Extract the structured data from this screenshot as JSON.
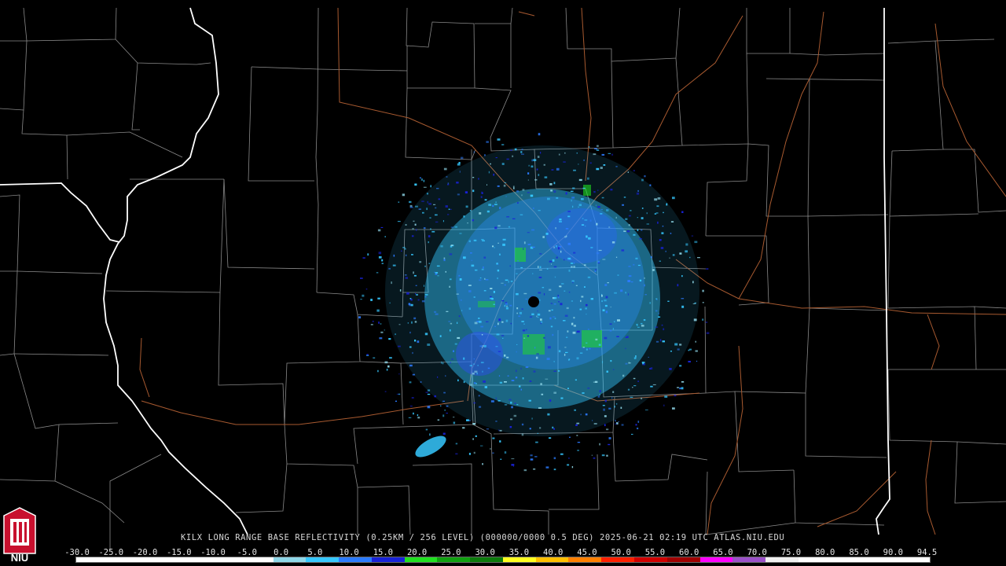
{
  "caption": "KILX LONG RANGE BASE REFLECTIVITY (0.25KM / 256 LEVEL) (000000/0000 0.5 DEG) 2025-06-21 02:19 UTC  ATLAS.NIU.EDU",
  "logo": {
    "text": "NIU"
  },
  "radar_site": {
    "id": "KILX"
  },
  "scale": {
    "labels": [
      "-30.0",
      "-25.0",
      "-20.0",
      "-15.0",
      "-10.0",
      "-5.0",
      "0.0",
      "5.0",
      "10.0",
      "15.0",
      "20.0",
      "25.0",
      "30.0",
      "35.0",
      "40.0",
      "45.0",
      "50.0",
      "55.0",
      "60.0",
      "65.0",
      "70.0",
      "75.0",
      "80.0",
      "85.0",
      "90.0",
      "94.5"
    ],
    "colors": [
      "#ffffff",
      "#ffffff",
      "#ffffff",
      "#ffffff",
      "#ffffff",
      "#ffffff",
      "#8fd7e8",
      "#36c8ff",
      "#2b7bff",
      "#1822d8",
      "#20e020",
      "#10a010",
      "#0c7a0c",
      "#ffff20",
      "#ffc000",
      "#ff8000",
      "#ff2000",
      "#d00000",
      "#a00000",
      "#ff00ff",
      "#9a50c8",
      "#f0f0f0",
      "#ffffff",
      "#ffffff",
      "#ffffff",
      "#ffffff"
    ]
  },
  "colors": {
    "background": "#000000",
    "county": "#8a8a8a",
    "state": "#ffffff",
    "highway": "#a85a30"
  }
}
